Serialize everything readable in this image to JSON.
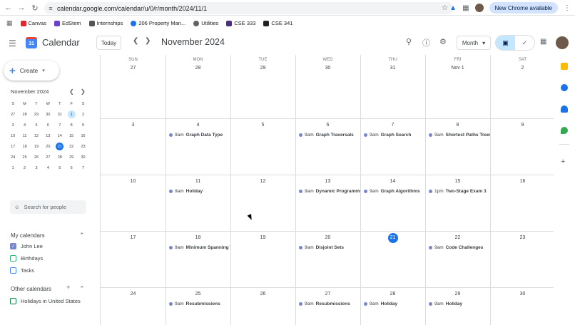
{
  "browser": {
    "url": "calendar.google.com/calendar/u/0/r/month/2024/11/1",
    "update_label": "New Chrome available",
    "bookmarks": [
      {
        "label": "Canvas",
        "color": "#e72429"
      },
      {
        "label": "EdStem",
        "color": "#6a3ed1"
      },
      {
        "label": "Internships",
        "color": "#555555"
      },
      {
        "label": "206 Property Man...",
        "color": "#1a73e8"
      },
      {
        "label": "Utilities",
        "color": "#5f6368"
      },
      {
        "label": "CSE 333",
        "color": "#4b2e83"
      },
      {
        "label": "CSE 341",
        "color": "#202124"
      }
    ]
  },
  "header": {
    "app_title": "Calendar",
    "today_label": "Today",
    "month_title": "November 2024",
    "view_label": "Month"
  },
  "sidebar": {
    "create_label": "Create",
    "mini_title": "November 2024",
    "mini_dow": [
      "S",
      "M",
      "T",
      "W",
      "T",
      "F",
      "S"
    ],
    "mini_weeks": [
      [
        "27",
        "28",
        "29",
        "30",
        "31",
        "1",
        "2"
      ],
      [
        "3",
        "4",
        "5",
        "6",
        "7",
        "8",
        "9"
      ],
      [
        "10",
        "11",
        "12",
        "13",
        "14",
        "15",
        "16"
      ],
      [
        "17",
        "18",
        "19",
        "20",
        "21",
        "22",
        "23"
      ],
      [
        "24",
        "25",
        "26",
        "27",
        "28",
        "29",
        "30"
      ],
      [
        "1",
        "2",
        "3",
        "4",
        "5",
        "6",
        "7"
      ]
    ],
    "search_placeholder": "Search for people",
    "my_calendars_title": "My calendars",
    "my_calendars": [
      {
        "label": "John Lee",
        "color": "#7986cb",
        "checked": true
      },
      {
        "label": "Birthdays",
        "color": "#33b679",
        "checked": false
      },
      {
        "label": "Tasks",
        "color": "#4285f4",
        "checked": false
      }
    ],
    "other_calendars_title": "Other calendars",
    "other_calendars": [
      {
        "label": "Holidays in United States",
        "color": "#0b8043",
        "checked": false
      }
    ]
  },
  "grid": {
    "dow": [
      "SUN",
      "MON",
      "TUE",
      "WED",
      "THU",
      "FRI",
      "SAT"
    ],
    "weeks": [
      {
        "days": [
          "27",
          "28",
          "29",
          "30",
          "31",
          "Nov 1",
          "2"
        ],
        "events": [
          null,
          null,
          null,
          null,
          null,
          null,
          null
        ]
      },
      {
        "days": [
          "3",
          "4",
          "5",
          "6",
          "7",
          "8",
          "9"
        ],
        "events": [
          null,
          {
            "time": "9am",
            "name": "Graph Data Type"
          },
          null,
          {
            "time": "9am",
            "name": "Graph Traversals"
          },
          {
            "time": "9am",
            "name": "Graph Search"
          },
          {
            "time": "9am",
            "name": "Shortest Paths Trees"
          },
          null
        ]
      },
      {
        "days": [
          "10",
          "11",
          "12",
          "13",
          "14",
          "15",
          "16"
        ],
        "events": [
          null,
          {
            "time": "9am",
            "name": "Holiday"
          },
          null,
          {
            "time": "9am",
            "name": "Dynamic Programming"
          },
          {
            "time": "9am",
            "name": "Graph Algorithms"
          },
          {
            "time": "1pm",
            "name": "Two-Stage Exam 3"
          },
          null
        ]
      },
      {
        "days": [
          "17",
          "18",
          "19",
          "20",
          "21",
          "22",
          "23"
        ],
        "events": [
          null,
          {
            "time": "9am",
            "name": "Minimum Spanning Trees"
          },
          null,
          {
            "time": "9am",
            "name": "Disjoint Sets"
          },
          null,
          {
            "time": "9am",
            "name": "Code Challenges"
          },
          null
        ]
      },
      {
        "days": [
          "24",
          "25",
          "26",
          "27",
          "28",
          "29",
          "30"
        ],
        "events": [
          null,
          {
            "time": "9am",
            "name": "Resubmissions"
          },
          null,
          {
            "time": "9am",
            "name": "Resubmissions"
          },
          {
            "time": "9am",
            "name": "Holiday"
          },
          {
            "time": "9am",
            "name": "Holiday"
          },
          null
        ]
      }
    ]
  },
  "colors": {
    "accent": "#1a73e8",
    "event_dot": "#7986cb"
  }
}
